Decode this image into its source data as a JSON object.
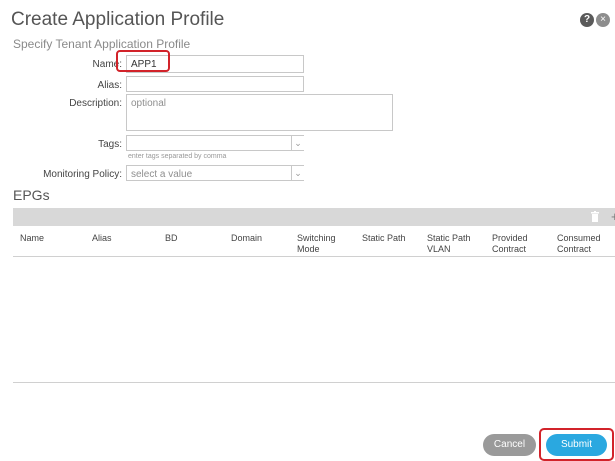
{
  "header": {
    "title": "Create Application Profile",
    "subtitle": "Specify Tenant Application Profile",
    "help_icon": "?",
    "close_icon": "×"
  },
  "form": {
    "name_label": "Name:",
    "name_value": "APP1",
    "alias_label": "Alias:",
    "alias_value": "",
    "description_label": "Description:",
    "description_placeholder": "optional",
    "tags_label": "Tags:",
    "tags_hint": "enter tags separated by comma",
    "monitoring_label": "Monitoring Policy:",
    "monitoring_value": "select a value"
  },
  "epgs": {
    "title": "EPGs",
    "columns": [
      "Name",
      "Alias",
      "BD",
      "Domain",
      "Switching Mode",
      "Static Path",
      "Static Path VLAN",
      "Provided Contract",
      "Consumed Contract"
    ],
    "rows": [],
    "toolbar_icons": [
      "trash-icon",
      "plus-icon"
    ]
  },
  "footer": {
    "cancel_label": "Cancel",
    "submit_label": "Submit"
  },
  "colors": {
    "accent": "#2aa8e0",
    "highlight": "#d2232a",
    "cancel": "#9a9a9a"
  }
}
